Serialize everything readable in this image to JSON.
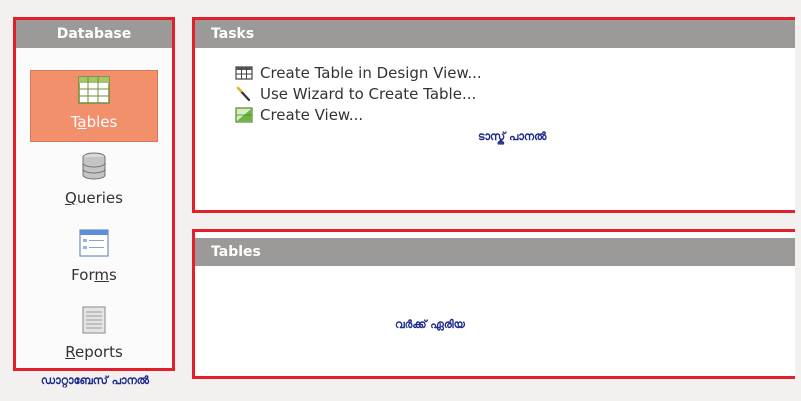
{
  "database_panel": {
    "title": "Database",
    "items": [
      {
        "pre": "T",
        "mnemonic": "a",
        "post": "bles",
        "selected": true
      },
      {
        "pre": "",
        "mnemonic": "Q",
        "post": "ueries",
        "selected": false
      },
      {
        "pre": "For",
        "mnemonic": "m",
        "post": "s",
        "selected": false
      },
      {
        "pre": "",
        "mnemonic": "R",
        "post": "eports",
        "selected": false
      }
    ],
    "caption": "ഡാറ്റാബേസ് പാനൽ"
  },
  "tasks_panel": {
    "title": "Tasks",
    "tasks": [
      {
        "label": "Create Table in Design View..."
      },
      {
        "label": "Use Wizard to Create Table..."
      },
      {
        "label": "Create View..."
      }
    ],
    "caption": "ടാസ്ക് പാനൽ"
  },
  "tables_panel": {
    "title": "Tables",
    "caption": "വർക്ക് ഏരിയ"
  },
  "colors": {
    "highlight_border": "#e0212b",
    "selected_item": "#f2906b",
    "header_bar": "#9c9a98",
    "caption_text": "#1d2b8a"
  }
}
